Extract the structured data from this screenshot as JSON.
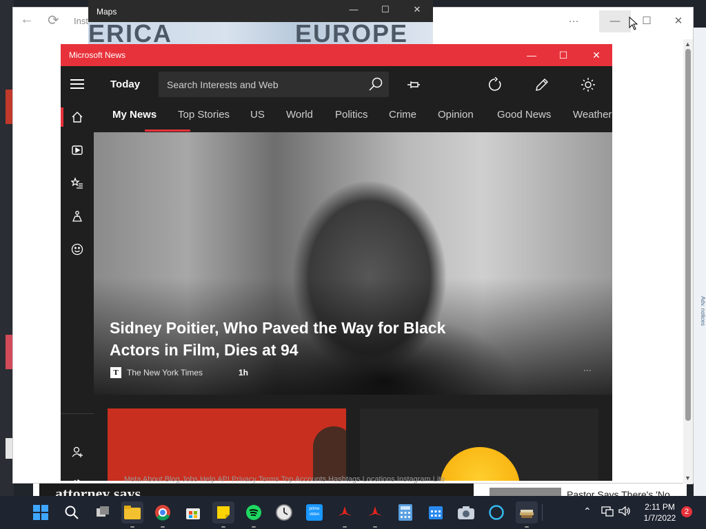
{
  "background_browser": {
    "url_text": "Inst",
    "footer_links": "Meta   About   Blog   Jobs   Help   API   Privacy   Terms   Top Accounts   Hashtags   Locations   Instagram Lite",
    "headline_partial": "attorney says",
    "side_story": "Pastor Says There's 'No",
    "ad_label": "Adv. notices",
    "min_glyph": "—",
    "max_glyph": "☐",
    "close_glyph": "✕",
    "more_glyph": "···"
  },
  "maps": {
    "title": "Maps",
    "label_left": "ERICA",
    "label_right": "EUROPE"
  },
  "news": {
    "title": "Microsoft News",
    "today": "Today",
    "search": {
      "placeholder": "Search Interests and Web"
    },
    "more_glyph": "···",
    "tabs": [
      "My News",
      "Top Stories",
      "US",
      "World",
      "Politics",
      "Crime",
      "Opinion",
      "Good News",
      "Weather"
    ],
    "active_tab": "My News",
    "hero": {
      "headline": "Sidney Poitier, Who Paved the Way for Black Actors in Film, Dies at 94",
      "source": "The New York Times",
      "source_logo": "T",
      "age": "1h",
      "more": "···"
    }
  },
  "taskbar": {
    "time": "2:11 PM",
    "date": "1/7/2022",
    "notification_count": "2",
    "prime_label": "prime video",
    "apps": [
      "start-icon",
      "search-icon",
      "task-view-icon",
      "file-explorer-icon",
      "chrome-icon",
      "store-icon",
      "sticky-notes-icon",
      "spotify-icon",
      "clock-icon",
      "prime-video-icon",
      "acrobat-icon",
      "acrobat-icon",
      "calculator-icon",
      "calendar-icon",
      "camera-icon",
      "cortana-icon",
      "books-icon"
    ]
  },
  "colors": {
    "accent": "#e8323b",
    "news_bg": "#1f1f1f",
    "taskbar": "#1e2430"
  }
}
